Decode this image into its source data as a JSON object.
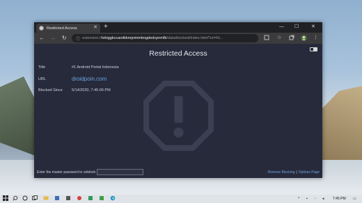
{
  "browser": {
    "tab_title": "Restricted Access",
    "new_tab": "+",
    "address": {
      "prefix": "extension://",
      "bright": "lebiggkccaodkkmjeimmbogdedcpnmfb",
      "suffix": "/data/blocked/index.html?url=ht..."
    },
    "icons": {
      "back": "←",
      "forward": "→",
      "refresh": "↻",
      "info": "ⓘ",
      "close": "✕",
      "minimize": "—",
      "maximize": "☐"
    }
  },
  "page": {
    "title": "Restricted Access",
    "rows": {
      "title_label": "Title",
      "title_value": "#1 Android Portal Indonesia",
      "url_label": "URL",
      "url_value": "droidpoin.com",
      "blocked_label": "Blocked Since",
      "blocked_value": "5/14/2020, 7:45:06 PM"
    },
    "password_prompt": "Enter the master password to unblock:",
    "remove_blocking": "Remove Blocking",
    "separator": "|",
    "options_page": "Options Page"
  },
  "taskbar": {
    "clock": "7:45 PM"
  }
}
